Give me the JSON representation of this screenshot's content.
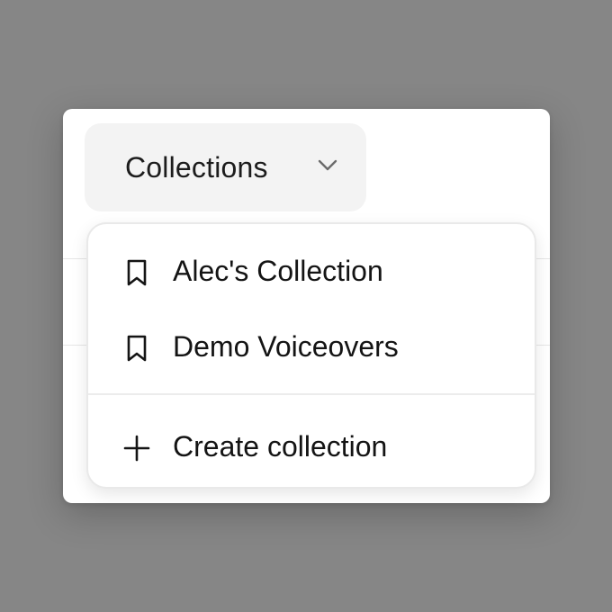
{
  "trigger": {
    "label": "Collections",
    "icon": "chevron-down-icon"
  },
  "menu": {
    "items": [
      {
        "label": "Alec's Collection",
        "icon": "bookmark-icon"
      },
      {
        "label": "Demo Voiceovers",
        "icon": "bookmark-icon"
      }
    ],
    "create": {
      "label": "Create collection",
      "icon": "plus-icon"
    }
  },
  "colors": {
    "backdrop": "#868686",
    "surface": "#ffffff",
    "trigger_bg": "#f3f3f3",
    "text": "#141414",
    "border": "#e9e9e9"
  }
}
